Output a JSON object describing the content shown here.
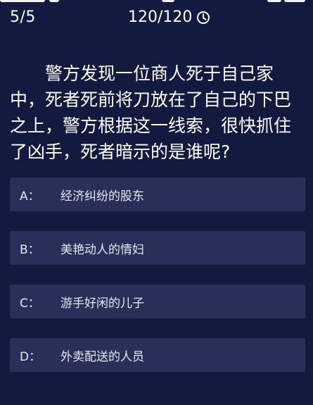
{
  "header": {
    "progress": "5/5",
    "timer": "120/120",
    "timer_icon": "clock-icon"
  },
  "question": {
    "text": "警方发现一位商人死于自己家中，死者死前将刀放在了自己的下巴之上，警方根据这一线索，很快抓住了凶手，死者暗示的是谁呢?"
  },
  "options": [
    {
      "key": "A：",
      "text": "经济纠纷的股东"
    },
    {
      "key": "B：",
      "text": "美艳动人的情妇"
    },
    {
      "key": "C：",
      "text": "游手好闲的儿子"
    },
    {
      "key": "D：",
      "text": "外卖配送的人员"
    }
  ],
  "colors": {
    "background": "#121a40",
    "option_background": "#28305a",
    "text": "#ffffff"
  }
}
